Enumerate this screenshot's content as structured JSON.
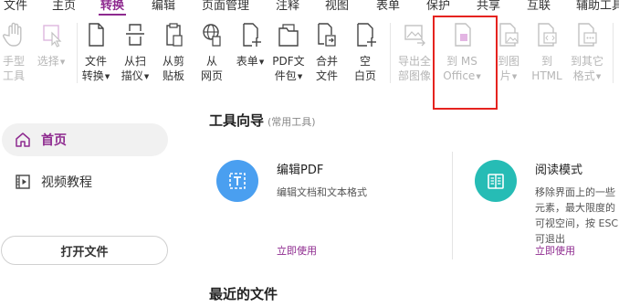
{
  "menubar": {
    "items": [
      {
        "label": "文件"
      },
      {
        "label": "主页"
      },
      {
        "label": "转换",
        "active": true
      },
      {
        "label": "编辑"
      },
      {
        "label": "页面管理"
      },
      {
        "label": "注释"
      },
      {
        "label": "视图"
      },
      {
        "label": "表单"
      },
      {
        "label": "保护"
      },
      {
        "label": "共享"
      },
      {
        "label": "互联"
      },
      {
        "label": "辅助工具"
      }
    ]
  },
  "toolbar": {
    "tools": [
      {
        "label": "手型\n工具",
        "icon": "hand-icon",
        "enabled": false
      },
      {
        "label": "选择",
        "icon": "select-icon",
        "enabled": false,
        "dropdown": true
      },
      {
        "label": "文件\n转换",
        "icon": "file-convert-icon",
        "enabled": true,
        "dropdown": true
      },
      {
        "label": "从扫\n描仪",
        "icon": "scanner-icon",
        "enabled": true,
        "dropdown": true
      },
      {
        "label": "从剪\n贴板",
        "icon": "clipboard-icon",
        "enabled": true
      },
      {
        "label": "从\n网页",
        "icon": "web-icon",
        "enabled": true
      },
      {
        "label": "表单",
        "icon": "form-icon",
        "enabled": true,
        "dropdown": true
      },
      {
        "label": "PDF文\n件包",
        "icon": "pdf-package-icon",
        "enabled": true,
        "dropdown": true
      },
      {
        "label": "合并\n文件",
        "icon": "combine-files-icon",
        "enabled": true
      },
      {
        "label": "空\n白页",
        "icon": "blank-page-icon",
        "enabled": true
      },
      {
        "label": "导出全\n部图像",
        "icon": "export-images-icon",
        "enabled": false
      },
      {
        "label": "到 MS\nOffice",
        "icon": "to-ms-office-icon",
        "enabled": false,
        "dropdown": true
      },
      {
        "label": "到图\n片",
        "icon": "to-image-icon",
        "enabled": false,
        "dropdown": true
      },
      {
        "label": "到\nHTML",
        "icon": "to-html-icon",
        "enabled": false
      },
      {
        "label": "到其它\n格式",
        "icon": "to-other-format-icon",
        "enabled": false,
        "dropdown": true
      }
    ]
  },
  "sidebar": {
    "items": [
      {
        "label": "首页",
        "icon": "home-icon",
        "selected": true
      },
      {
        "label": "视频教程",
        "icon": "video-icon",
        "selected": false
      }
    ],
    "open_button": "打开文件"
  },
  "main": {
    "section_title": "工具向导",
    "section_subtitle": "(常用工具)",
    "cards": [
      {
        "title": "编辑PDF",
        "desc": "编辑文档和文本格式",
        "link": "立即使用",
        "icon": "edit-pdf-icon",
        "color": "#4a9ff0"
      },
      {
        "title": "阅读模式",
        "desc": "移除界面上的一些元素，最大限度的可视空间，按 ESC 可退出",
        "link": "立即使用",
        "icon": "read-mode-icon",
        "color": "#26bcb5"
      }
    ],
    "recent_title": "最近的文件"
  },
  "colors": {
    "accent": "#8e2a8f",
    "highlight": "#e5231f"
  }
}
